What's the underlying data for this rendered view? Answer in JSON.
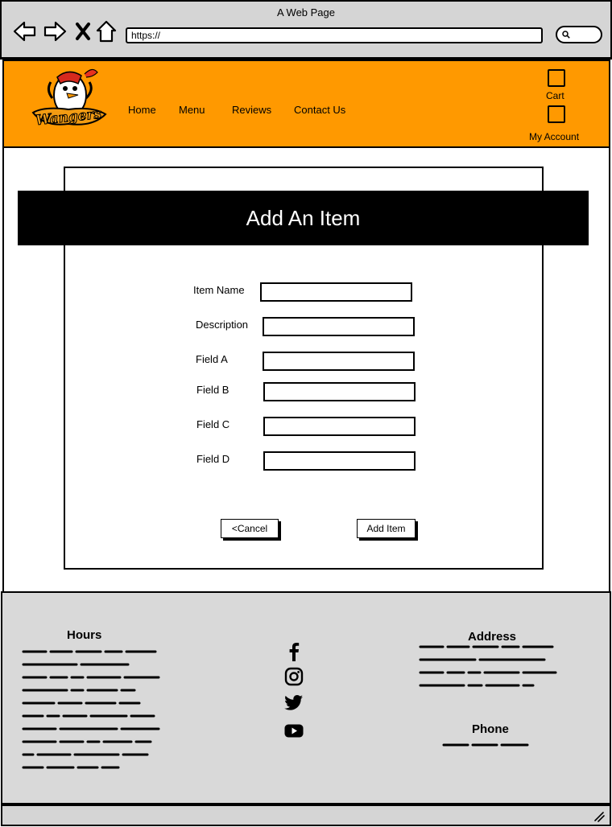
{
  "browser": {
    "title": "A Web Page",
    "url": "https://",
    "icons": {
      "back": "arrow-left-icon",
      "forward": "arrow-right-icon",
      "close": "close-icon",
      "home": "home-icon",
      "search": "search-icon"
    }
  },
  "header": {
    "logo_text": "Wangers",
    "nav": [
      {
        "label": "Home"
      },
      {
        "label": "Menu"
      },
      {
        "label": "Reviews"
      },
      {
        "label": "Contact Us"
      }
    ],
    "cart_label": "Cart",
    "account_label": "My Account"
  },
  "form": {
    "title": "Add An Item",
    "fields": [
      {
        "label": "Item Name",
        "value": ""
      },
      {
        "label": "Description",
        "value": ""
      },
      {
        "label": "Field A",
        "value": ""
      },
      {
        "label": "Field B",
        "value": ""
      },
      {
        "label": "Field C",
        "value": ""
      },
      {
        "label": "Field D",
        "value": ""
      }
    ],
    "cancel_label": "<Cancel",
    "submit_label": "Add Item"
  },
  "footer": {
    "hours_title": "Hours",
    "address_title": "Address",
    "phone_title": "Phone",
    "social": [
      "facebook-icon",
      "instagram-icon",
      "twitter-icon",
      "youtube-icon"
    ]
  },
  "colors": {
    "header_bg": "#ff9900",
    "banner_bg": "#000000",
    "footer_bg": "#d9d9d9",
    "chrome_bg": "#d5d5d5"
  }
}
